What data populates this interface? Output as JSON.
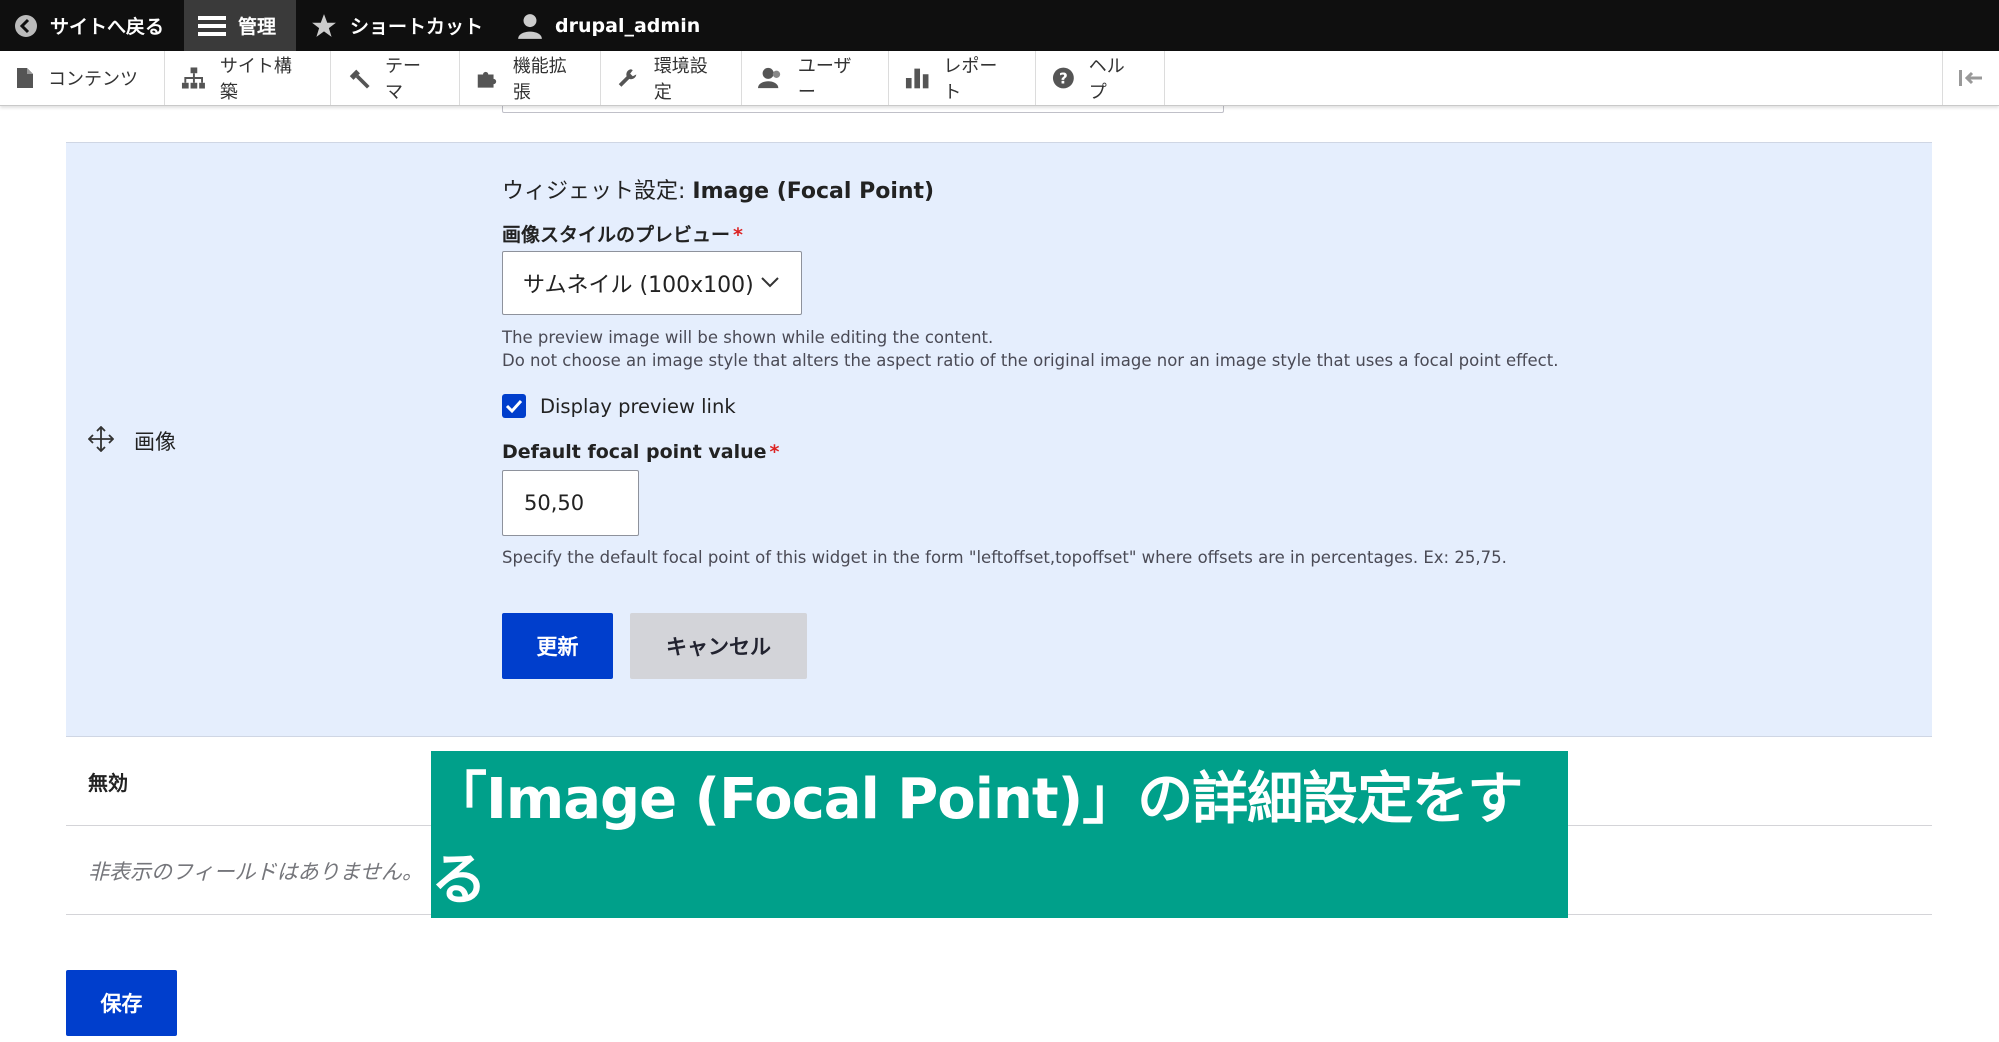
{
  "toolbar": {
    "back_label": "サイトへ戻る",
    "manage_label": "管理",
    "shortcuts_label": "ショートカット",
    "user_label": "drupal_admin"
  },
  "tray": {
    "items": [
      {
        "label": "コンテンツ",
        "icon": "file-icon"
      },
      {
        "label": "サイト構築",
        "icon": "sitemap-icon"
      },
      {
        "label": "テーマ",
        "icon": "paintbrush-icon"
      },
      {
        "label": "機能拡張",
        "icon": "puzzle-icon"
      },
      {
        "label": "環境設定",
        "icon": "wrench-icon"
      },
      {
        "label": "ユーザー",
        "icon": "people-icon"
      },
      {
        "label": "レポート",
        "icon": "bar-chart-icon"
      },
      {
        "label": "ヘルプ",
        "icon": "help-icon"
      }
    ]
  },
  "field_row": {
    "label": "画像",
    "widget_prefix": "ウィジェット設定: ",
    "widget_name": "Image (Focal Point)",
    "preview_style_label": "画像スタイルのプレビュー",
    "preview_style_value": "サムネイル (100x100)",
    "preview_desc_line1": "The preview image will be shown while editing the content.",
    "preview_desc_line2": "Do not choose an image style that alters the aspect ratio of the original image nor an image style that uses a focal point effect.",
    "display_preview_link_label": "Display preview link",
    "display_preview_link_checked": true,
    "focal_label": "Default focal point value",
    "focal_value": "50,50",
    "focal_desc": "Specify the default focal point of this widget in the form \"leftoffset,topoffset\" where offsets are in percentages. Ex: 25,75.",
    "update_button": "更新",
    "cancel_button": "キャンセル",
    "required_mark": "*"
  },
  "disabled_region": {
    "title": "無効",
    "empty_message": "非表示のフィールドはありません。"
  },
  "save_button": "保存",
  "banner_text": "「Image (Focal Point)」の詳細設定をする",
  "colors": {
    "primary": "#003ecc",
    "row_highlight": "#e5eefd",
    "banner": "#00a08a",
    "toolbar": "#0f0f0f",
    "required": "#dc2323"
  }
}
